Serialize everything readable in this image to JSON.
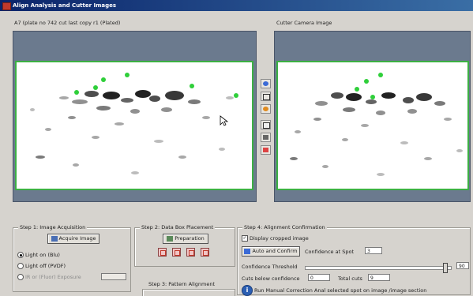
{
  "window": {
    "title": "Align Analysis and Cutter Images",
    "icon": "app-icon"
  },
  "left_panel": {
    "caption": "A7 (plate no 742 cut last copy r1 (Plated)"
  },
  "right_panel": {
    "caption": "Cutter Camera Image"
  },
  "toolbar": {
    "icons": [
      "zoom-in-icon",
      "crop-icon",
      "color-icon",
      "frame-icon",
      "camera-icon",
      "gel-icon"
    ]
  },
  "step1": {
    "title": "Step 1: Image Acquisition",
    "acquire_button": "Acquire Image",
    "options": [
      "Light on (Blu)",
      "Light off (PVDF)",
      "IR or (Fluor)  Exposure"
    ],
    "selected_index": 0
  },
  "step2": {
    "title": "Step 2: Data Box Placement",
    "button": "Preparation",
    "pattern_title": "Step 3: Pattern Alignment"
  },
  "step4": {
    "title": "Step 4: Alignment Confirmation",
    "display_checkbox": "Display cropped image",
    "display_checked": true,
    "auto_button": "Auto and Confirm",
    "confidence_label": "Confidence at Spot",
    "confidence_value": "3",
    "threshold_label": "Confidence Threshold",
    "threshold_level": 0.95,
    "threshold_value": "90",
    "cuts_label": "Cuts below confidence",
    "cuts_value": "0",
    "total_label": "Total cuts",
    "total_value": "9",
    "manual_text": "Run Manual Correction   Anal selected spot on image /image section"
  }
}
